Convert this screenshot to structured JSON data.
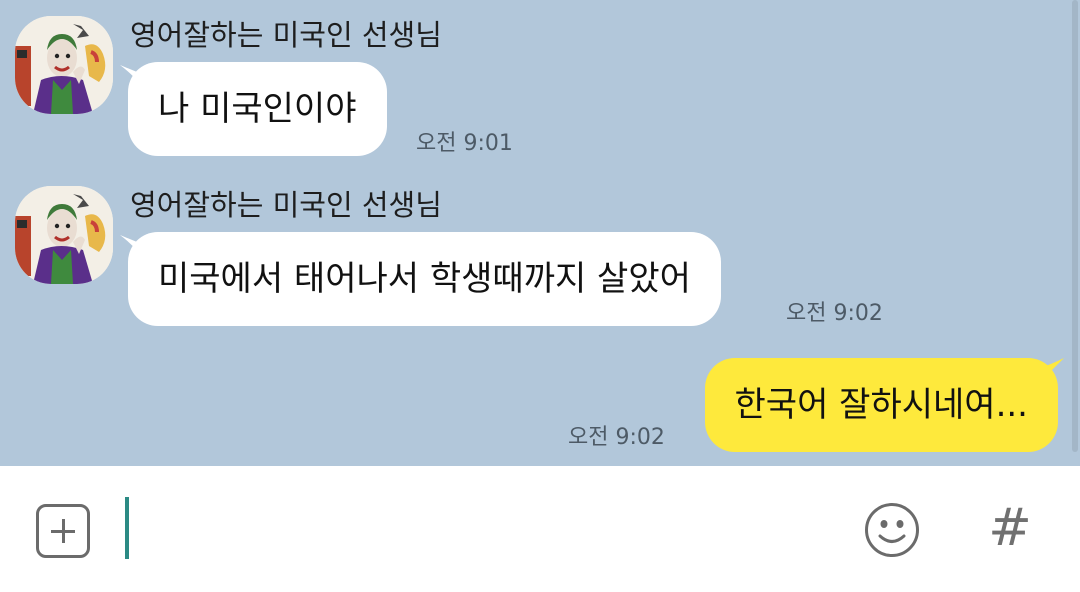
{
  "chat": {
    "messages": [
      {
        "sender": "영어잘하는 미국인 선생님",
        "text": "나 미국인이야",
        "time": "오전 9:01",
        "direction": "incoming",
        "avatar": "joker-profile-avatar"
      },
      {
        "sender": "영어잘하는 미국인 선생님",
        "text": "미국에서 태어나서 학생때까지 살았어",
        "time": "오전 9:02",
        "direction": "incoming",
        "avatar": "joker-profile-avatar"
      },
      {
        "text": "한국어 잘하시네여...",
        "time": "오전 9:02",
        "direction": "outgoing"
      }
    ]
  },
  "input_bar": {
    "plus_icon": "plus-square-icon",
    "message_value": "",
    "emoji_icon": "smiley-face-icon",
    "hash_label": "#"
  },
  "colors": {
    "chat_background": "#b2c7da",
    "incoming_bubble": "#ffffff",
    "outgoing_bubble": "#fee93c",
    "cursor": "#2b8a84"
  }
}
